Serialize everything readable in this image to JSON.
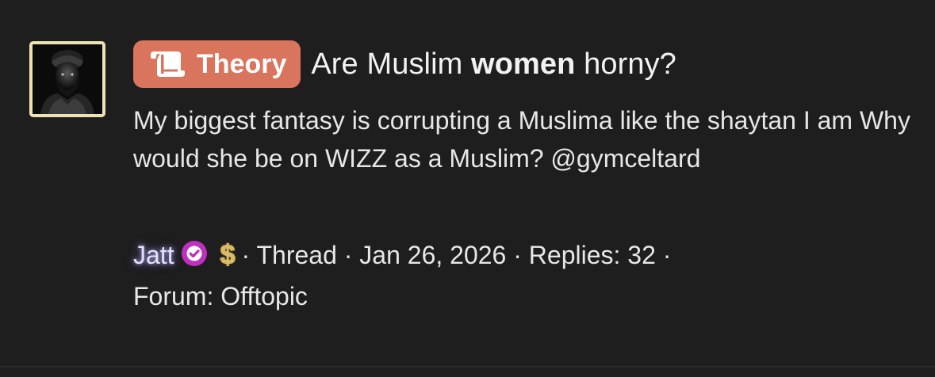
{
  "thread": {
    "prefix": "Theory",
    "title_before": "Are Muslim ",
    "title_bold": "women",
    "title_after": " horny?",
    "snippet": "My biggest fantasy is corrupting a Muslima like the shaytan I am Why would she be on WIZZ as a Muslim? @gymceltard",
    "author": "Jatt",
    "verified_icon": "verified-check-icon",
    "currency_icon": "dollar-sign-icon",
    "meta_type": "· Thread ·",
    "meta_date": "Jan 26, 2026",
    "meta_replies": "· Replies: 32 ·",
    "meta_forum": "Forum: Offtopic"
  },
  "colors": {
    "background": "#1e1e1f",
    "prefix_badge": "#d9745d",
    "avatar_border": "#efe3b6",
    "verified_badge": "#c02fbf",
    "username_glow": "#bebaff"
  }
}
